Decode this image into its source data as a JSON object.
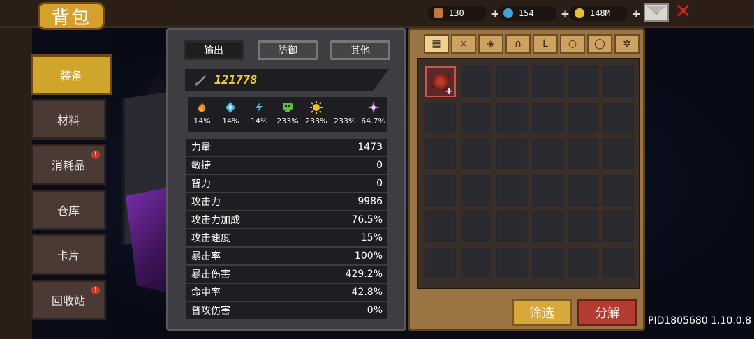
{
  "title": "背包",
  "resources": [
    {
      "value": "130",
      "icon": "meat-icon",
      "color": "#c0783a"
    },
    {
      "value": "154",
      "icon": "gem-icon",
      "color": "#3fa3d9"
    },
    {
      "value": "148M",
      "icon": "coin-icon",
      "color": "#e6c029"
    }
  ],
  "nav": [
    {
      "label": "装备",
      "active": true
    },
    {
      "label": "材料"
    },
    {
      "label": "消耗品",
      "badge": "!"
    },
    {
      "label": "仓库"
    },
    {
      "label": "卡片"
    },
    {
      "label": "回收站",
      "badge": "!"
    }
  ],
  "tabs": [
    "输出",
    "防御",
    "其他"
  ],
  "power": "121778",
  "elements": [
    {
      "icon": "fire-icon",
      "value": "14%",
      "color": "#f08a24"
    },
    {
      "icon": "ice-icon",
      "value": "14%",
      "color": "#43b6ef"
    },
    {
      "icon": "lightning-icon",
      "value": "14%",
      "color": "#4fb0f0"
    },
    {
      "icon": "poison-skull-icon",
      "value": "233%",
      "color": "#5cbf3a"
    },
    {
      "icon": "light-sun-icon",
      "value": "233%",
      "color": "#f2c020"
    },
    {
      "icon": "dark-moon-icon",
      "value": "233%",
      "color": "#c22c3a"
    },
    {
      "icon": "arcane-icon",
      "value": "64.7%",
      "color": "#c468e0"
    }
  ],
  "stats": [
    {
      "label": "力量",
      "value": "1473"
    },
    {
      "label": "敏捷",
      "value": "0"
    },
    {
      "label": "智力",
      "value": "0"
    },
    {
      "label": "攻击力",
      "value": "9986"
    },
    {
      "label": "攻击力加成",
      "value": "76.5%"
    },
    {
      "label": "攻击速度",
      "value": "15%"
    },
    {
      "label": "暴击率",
      "value": "100%"
    },
    {
      "label": "暴击伤害",
      "value": "429.2%"
    },
    {
      "label": "命中率",
      "value": "42.8%"
    },
    {
      "label": "普攻伤害",
      "value": "0%"
    }
  ],
  "categories": [
    "all-grid-icon",
    "weapon-icon",
    "armor-icon",
    "helmet-icon",
    "boots-icon",
    "necklace-icon",
    "ring-icon",
    "gear-icon"
  ],
  "buttons": {
    "filter": "筛选",
    "decompose": "分解"
  },
  "version": "PID1805680 1.10.0.8"
}
